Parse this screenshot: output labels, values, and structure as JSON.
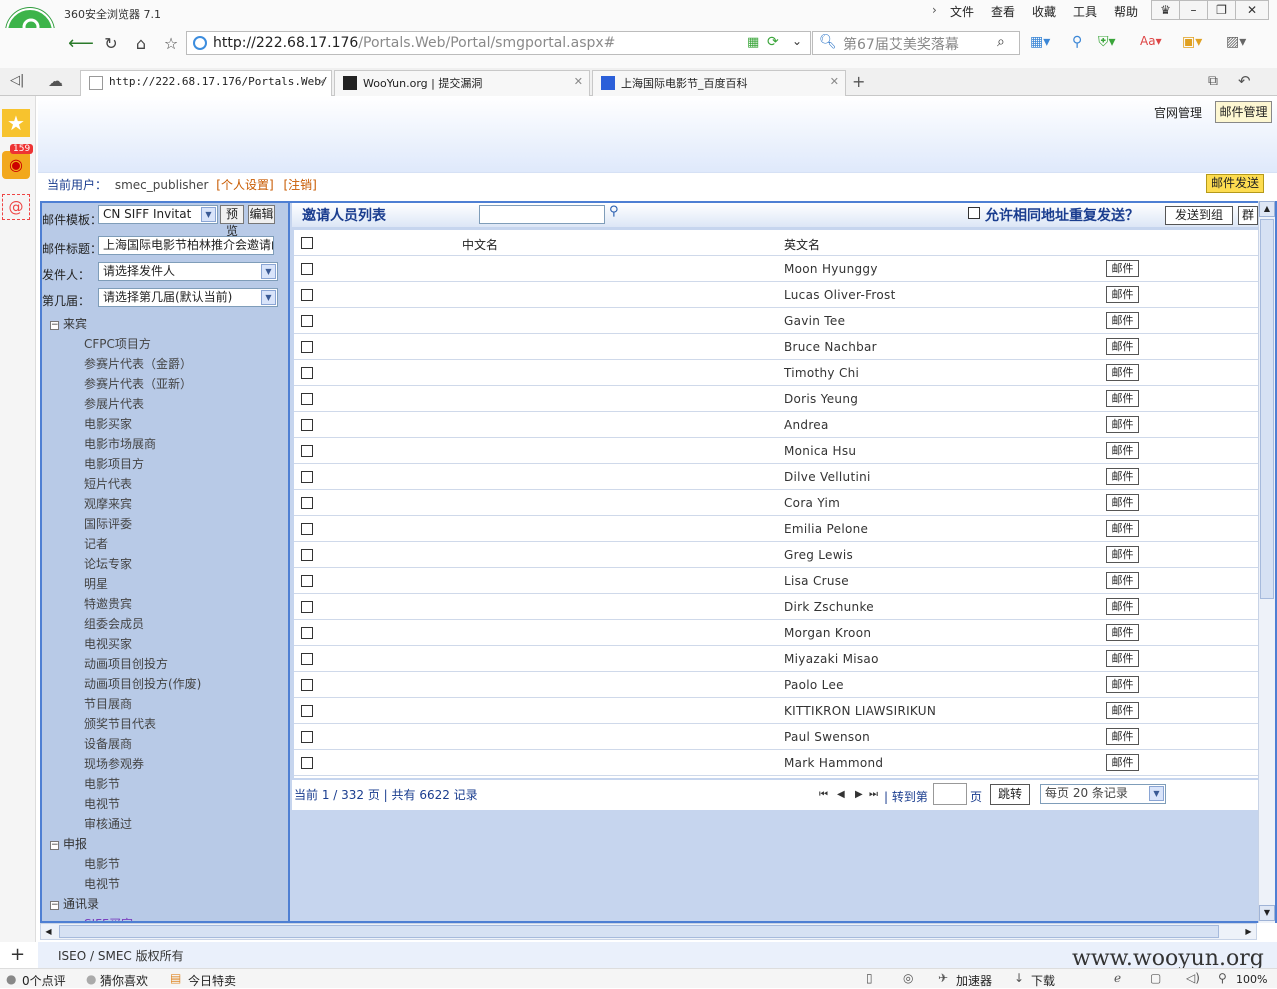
{
  "browser": {
    "title": "360安全浏览器 7.1",
    "menus": [
      "文件",
      "查看",
      "收藏",
      "工具",
      "帮助"
    ],
    "address_host": "http://222.68.17.176",
    "address_path": "/Portals.Web/Portal/smgportal.aspx#",
    "search_text": "第67届艾美奖落幕",
    "tabs": [
      {
        "label": "http://222.68.17.176/Portals.Web/",
        "active": true
      },
      {
        "label": "WooYun.org | 提交漏洞",
        "active": false
      },
      {
        "label": "上海国际电影节_百度百科",
        "active": false
      }
    ],
    "badge_count": "159"
  },
  "header": {
    "nav_site": "官网管理",
    "nav_mail": "邮件管理",
    "current_user_label": "当前用户：",
    "current_user": "smec_publisher",
    "personal_settings": "[个人设置]",
    "logout": "[注销]",
    "mail_send": "邮件发送"
  },
  "form": {
    "template_label": "邮件模板：",
    "template_value": "CN SIFF Invitat",
    "preview": "预览",
    "edit": "编辑",
    "subject_label": "邮件标题：",
    "subject_value": "上海国际电影节柏林推介会邀请函",
    "sender_label": "发件人：",
    "sender_value": "请选择发件人",
    "edition_label": "第几届：",
    "edition_value": "请选择第几届(默认当前)"
  },
  "tree": {
    "group1": "来宾",
    "group1_items": [
      "CFPC项目方",
      "参赛片代表（金爵）",
      "参赛片代表（亚新）",
      "参展片代表",
      "电影买家",
      "电影市场展商",
      "电影项目方",
      "短片代表",
      "观摩来宾",
      "国际评委",
      "记者",
      "论坛专家",
      "明星",
      "特邀贵宾",
      "组委会成员",
      "电视买家",
      "动画项目创投方",
      "动画项目创投方(作废)",
      "节目展商",
      "颁奖节目代表",
      "设备展商",
      "现场参观券",
      "电影节",
      "电视节",
      "审核通过"
    ],
    "group2": "申报",
    "group2_items": [
      "电影节",
      "电视节"
    ],
    "group3": "通讯录",
    "group3_items": [
      "SIFF买家"
    ]
  },
  "list": {
    "title": "邀请人员列表",
    "allow_duplicate": "允许相同地址重复发送？",
    "send_to_group": "发送到组",
    "group_cut": "群",
    "col_cn": "中文名",
    "col_en": "英文名",
    "mail_label": "邮件",
    "rows": [
      "Moon Hyunggy",
      "Lucas Oliver-Frost",
      "Gavin Tee",
      "Bruce Nachbar",
      "Timothy Chi",
      "Doris Yeung",
      "Andrea",
      "Monica Hsu",
      "Dilve Vellutini",
      "Cora Yim",
      "Emilia Pelone",
      "Greg Lewis",
      "Lisa Cruse",
      "Dirk Zschunke",
      "Morgan Kroon",
      "Miyazaki Misao",
      "Paolo Lee",
      "KITTIKRON LIAWSIRIKUN",
      "Paul Swenson",
      "Mark Hammond"
    ]
  },
  "pager": {
    "summary": "当前 1 / 332 页 | 共有 6622 记录",
    "goto_label": "| 转到第",
    "page_unit": "页",
    "jump": "跳转",
    "per_page": "每页 20 条记录"
  },
  "footer": {
    "copyright": "ISEO / SMEC 版权所有",
    "watermark": "www.wooyun.org"
  },
  "statusbar": {
    "comments": "0个点评",
    "guess": "猜你喜欢",
    "today": "今日特卖",
    "accelerator": "加速器",
    "download": "下载",
    "zoom": "100%"
  }
}
